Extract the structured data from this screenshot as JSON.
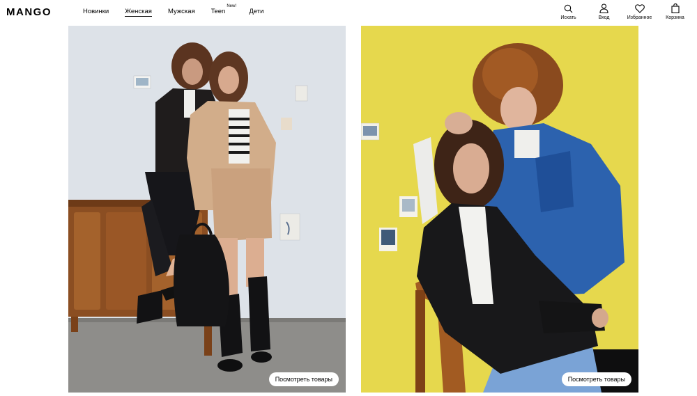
{
  "brand": {
    "logo": "MANGO"
  },
  "nav": {
    "items": [
      {
        "label": "Новинки"
      },
      {
        "label": "Женская"
      },
      {
        "label": "Мужская"
      },
      {
        "label": "Teen",
        "badge": "New!"
      },
      {
        "label": "Дети"
      }
    ]
  },
  "actions": {
    "search": {
      "label": "Искать",
      "icon": "search-icon"
    },
    "login": {
      "label": "Вход",
      "icon": "user-icon"
    },
    "favorites": {
      "label": "Избранное",
      "icon": "heart-icon"
    },
    "cart": {
      "label": "Корзина",
      "icon": "bag-icon"
    }
  },
  "cards": [
    {
      "cta": "Посмотреть товары"
    },
    {
      "cta": "Посмотреть товары"
    }
  ],
  "colors": {
    "left_wall": "#dde1e6",
    "right_wall": "#e7d94f",
    "wood": "#8a4e22",
    "denim": "#2f64b0"
  }
}
